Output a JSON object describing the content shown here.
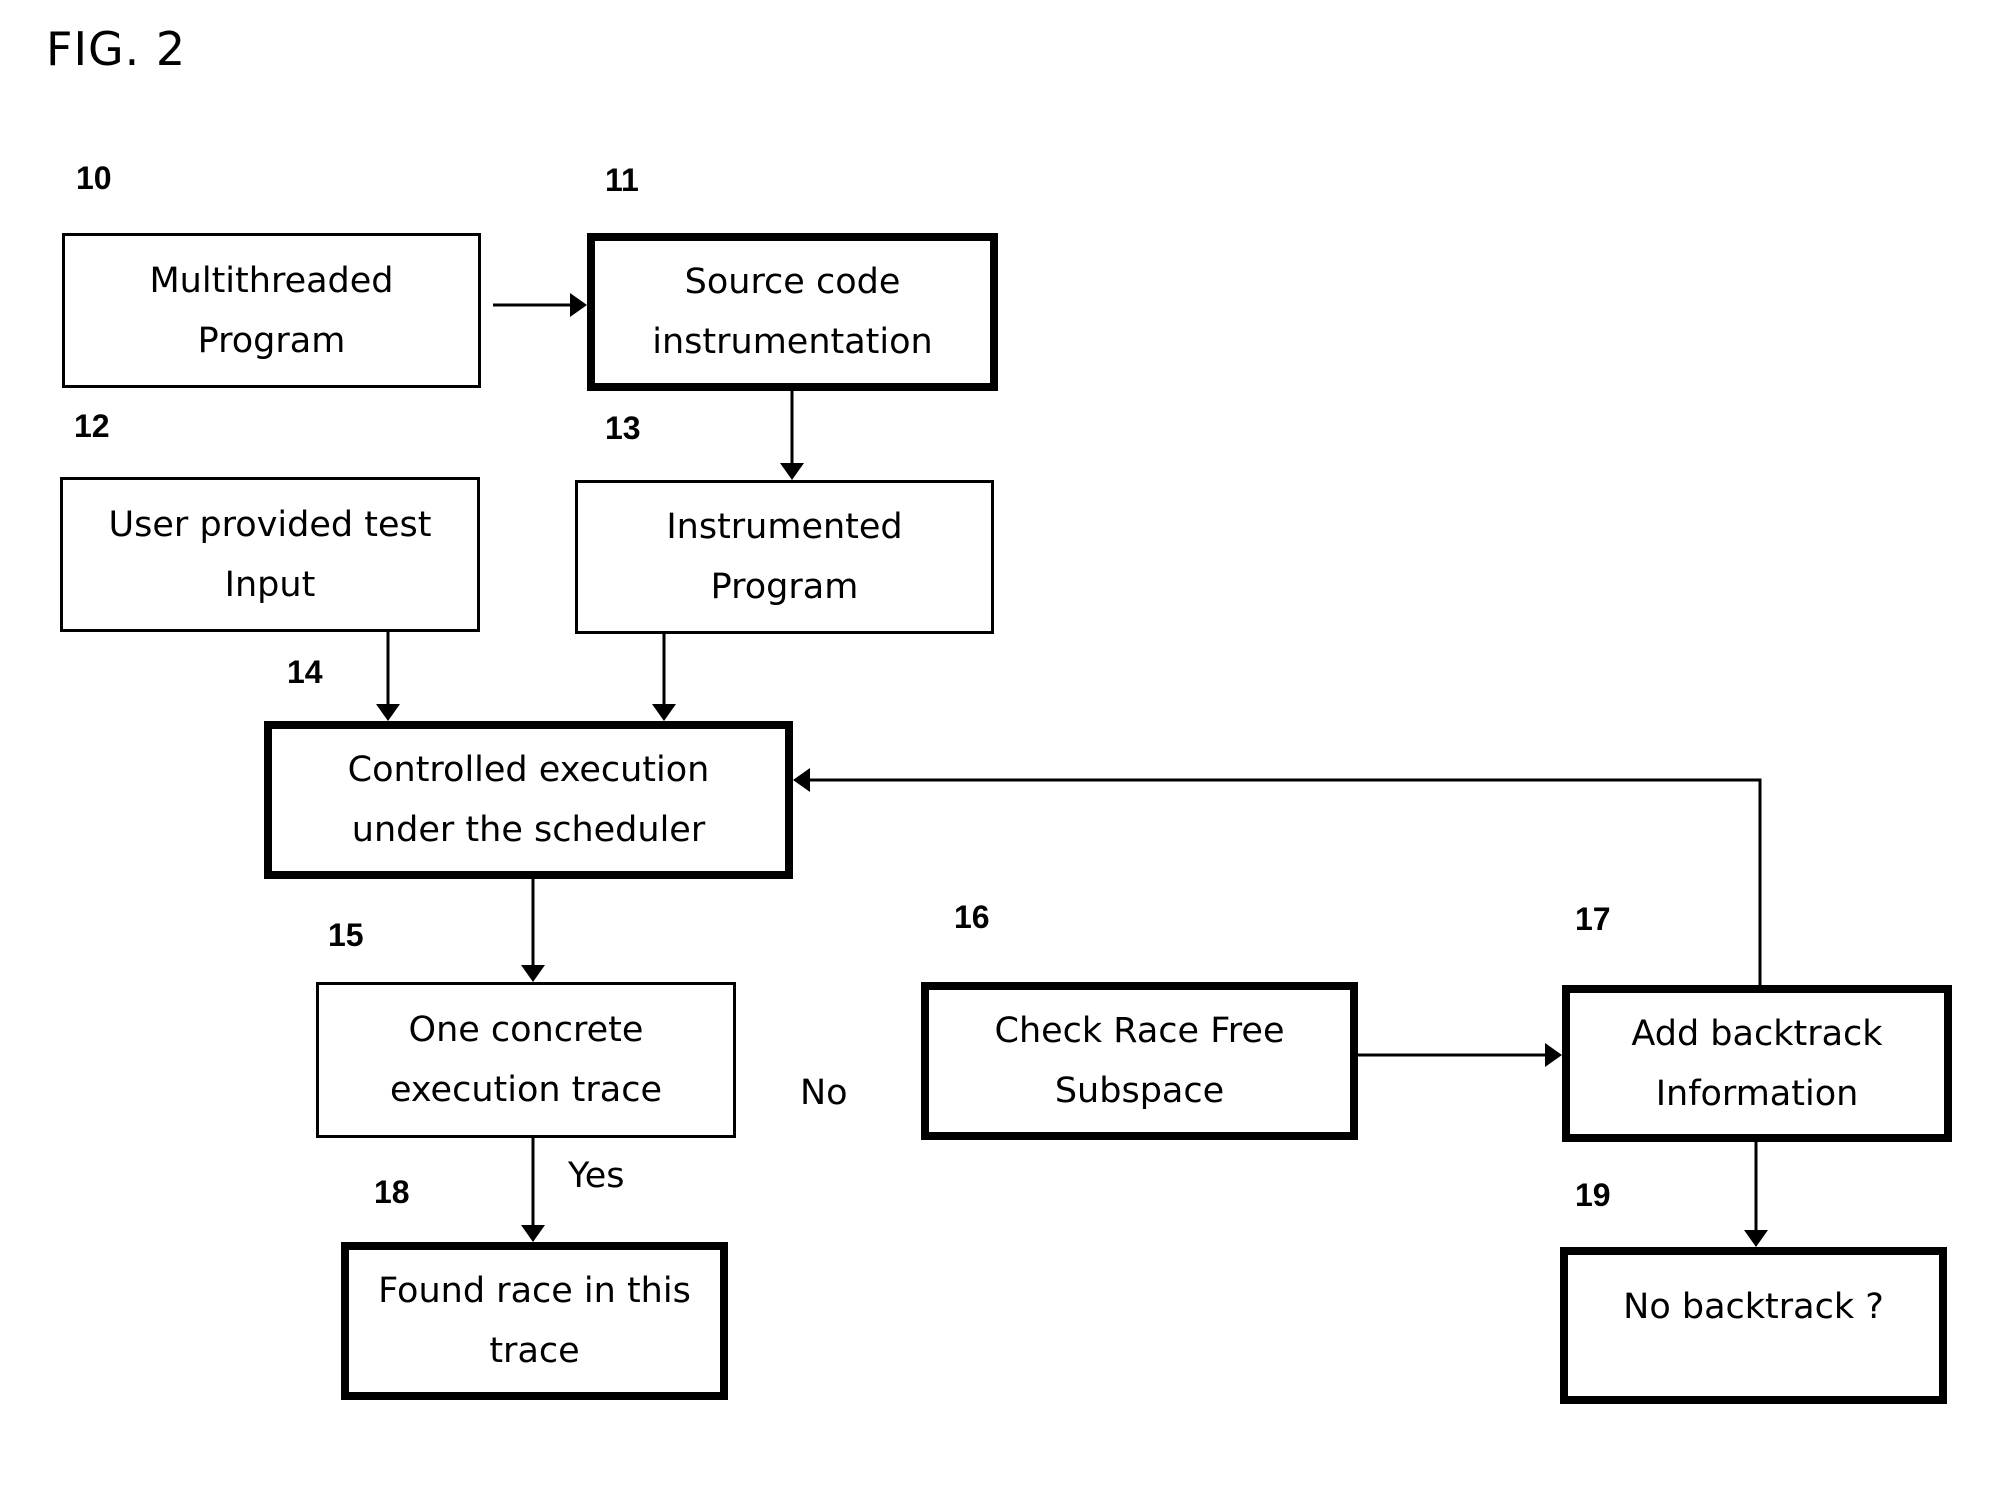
{
  "figure": {
    "title": "FIG. 2"
  },
  "nodes": [
    {
      "id": "10",
      "ref": "10",
      "lines": [
        "Multithreaded",
        "Program"
      ],
      "emphasis": "normal"
    },
    {
      "id": "11",
      "ref": "11",
      "lines": [
        "Source code",
        "instrumentation"
      ],
      "emphasis": "bold"
    },
    {
      "id": "12",
      "ref": "12",
      "lines": [
        "User provided test",
        "Input"
      ],
      "emphasis": "normal"
    },
    {
      "id": "13",
      "ref": "13",
      "lines": [
        "Instrumented",
        "Program"
      ],
      "emphasis": "normal"
    },
    {
      "id": "14",
      "ref": "14",
      "lines": [
        "Controlled execution",
        "under the scheduler"
      ],
      "emphasis": "bold"
    },
    {
      "id": "15",
      "ref": "15",
      "lines": [
        "One concrete",
        "execution trace"
      ],
      "emphasis": "normal"
    },
    {
      "id": "16",
      "ref": "16",
      "lines": [
        "Check Race Free",
        "Subspace"
      ],
      "emphasis": "bold"
    },
    {
      "id": "17",
      "ref": "17",
      "lines": [
        "Add backtrack",
        "Information"
      ],
      "emphasis": "bold"
    },
    {
      "id": "18",
      "ref": "18",
      "lines": [
        "Found race in this",
        "trace"
      ],
      "emphasis": "bold"
    },
    {
      "id": "19",
      "ref": "19",
      "lines": [
        "No backtrack ?"
      ],
      "emphasis": "bold"
    }
  ],
  "edges": [
    {
      "from": "10",
      "to": "11",
      "label": ""
    },
    {
      "from": "11",
      "to": "13",
      "label": ""
    },
    {
      "from": "12",
      "to": "14",
      "label": ""
    },
    {
      "from": "13",
      "to": "14",
      "label": ""
    },
    {
      "from": "14",
      "to": "15",
      "label": ""
    },
    {
      "from": "15",
      "to": "18",
      "label": "Yes"
    },
    {
      "from": "16",
      "to": "17",
      "label": ""
    },
    {
      "from": "17",
      "to": "19",
      "label": ""
    },
    {
      "from": "17",
      "to": "14",
      "label": ""
    }
  ],
  "branch_labels": {
    "yes": "Yes",
    "no": "No"
  }
}
